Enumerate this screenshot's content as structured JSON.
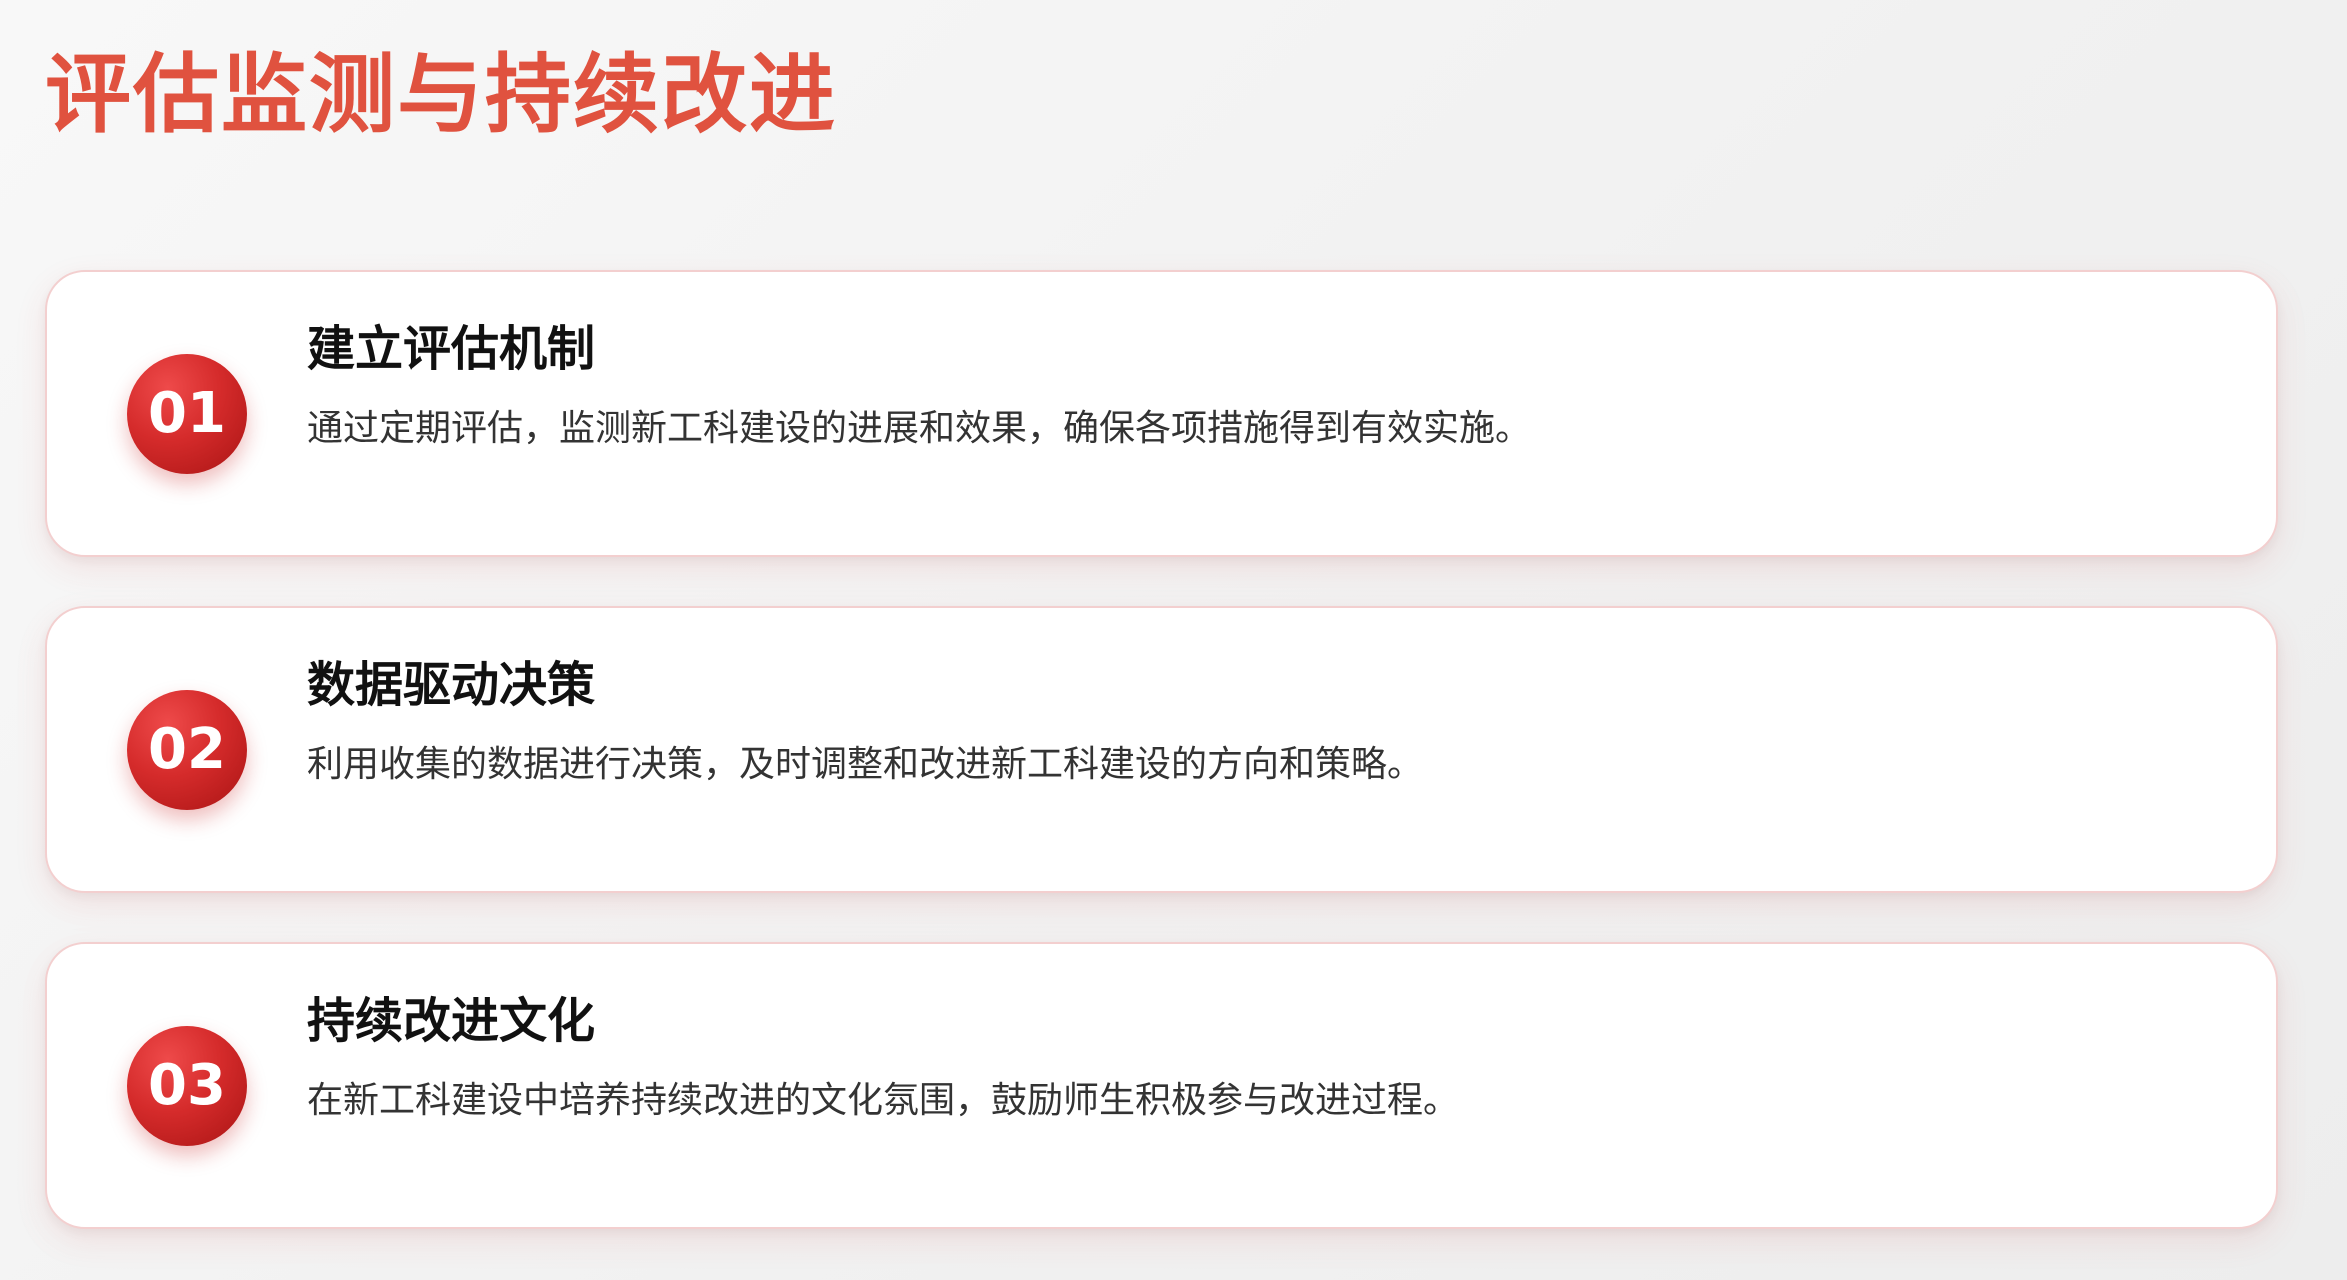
{
  "page": {
    "title": "评估监测与持续改进"
  },
  "items": [
    {
      "number": "01",
      "title": "建立评估机制",
      "description": "通过定期评估，监测新工科建设的进展和效果，确保各项措施得到有效实施。"
    },
    {
      "number": "02",
      "title": "数据驱动决策",
      "description": "利用收集的数据进行决策，及时调整和改进新工科建设的方向和策略。"
    },
    {
      "number": "03",
      "title": "持续改进文化",
      "description": "在新工科建设中培养持续改进的文化氛围，鼓励师生积极参与改进过程。"
    }
  ],
  "colors": {
    "title": "#e0523f",
    "badge": "#d52b2b",
    "card_border": "#f3cfcf"
  }
}
